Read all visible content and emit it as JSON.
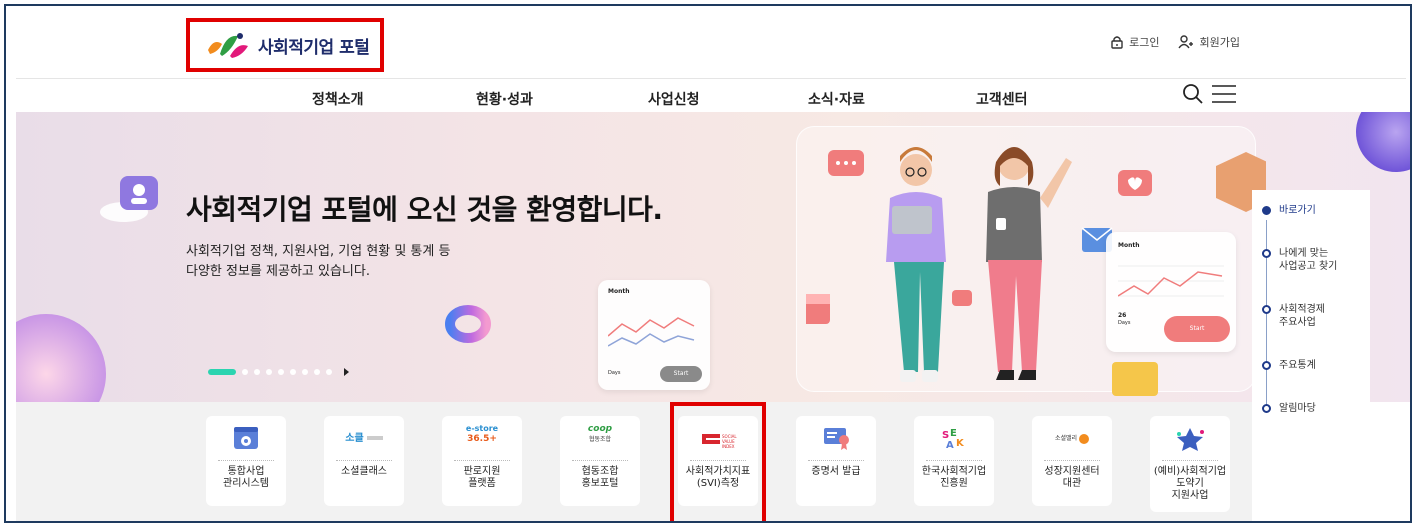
{
  "header": {
    "logo_text": "사회적기업 포털",
    "login_label": "로그인",
    "signup_label": "회원가입"
  },
  "gnb": {
    "items": [
      "정책소개",
      "현황·성과",
      "사업신청",
      "소식·자료",
      "고객센터"
    ]
  },
  "hero": {
    "title": "사회적기업 포털에 오신 것을 환영합니다.",
    "desc_line1": "사회적기업 정책, 지원사업, 기업 현황 및 통계 등",
    "desc_line2": "다양한 정보를 제공하고 있습니다.",
    "card_left_month": "Month",
    "card_left_days": "Days",
    "card_left_start": "Start",
    "card_right_month": "Month",
    "card_right_num": "26",
    "card_right_days": "Days",
    "card_right_start": "Start"
  },
  "quick_nav": {
    "items": [
      {
        "line1": "바로가기",
        "line2": ""
      },
      {
        "line1": "나에게 맞는",
        "line2": "사업공고 찾기"
      },
      {
        "line1": "사회적경제",
        "line2": "주요사업"
      },
      {
        "line1": "주요통계",
        "line2": ""
      },
      {
        "line1": "알림마당",
        "line2": ""
      }
    ]
  },
  "services": [
    {
      "line1": "통합사업",
      "line2": "관리시스템",
      "line3": "",
      "icon": "gear-window-icon"
    },
    {
      "line1": "소셜클래스",
      "line2": "",
      "line3": "",
      "icon": "social-class-logo",
      "logo": "소클"
    },
    {
      "line1": "판로지원",
      "line2": "플랫폼",
      "line3": "",
      "icon": "estore-logo",
      "logo": "e-store",
      "logo2": "36.5+"
    },
    {
      "line1": "협동조합",
      "line2": "홍보포털",
      "line3": "",
      "icon": "coop-logo",
      "logo": "coop",
      "logo2": "협동조합"
    },
    {
      "line1": "사회적가치지표",
      "line2": "(SVI)측정",
      "line3": "",
      "icon": "svi-logo"
    },
    {
      "line1": "증명서 발급",
      "line2": "",
      "line3": "",
      "icon": "certificate-icon"
    },
    {
      "line1": "한국사회적기업",
      "line2": "진흥원",
      "line3": "",
      "icon": "kosea-logo"
    },
    {
      "line1": "성장지원센터",
      "line2": "대관",
      "line3": "",
      "icon": "social-valley-logo",
      "logo": "소셜밸리"
    },
    {
      "line1": "(예비)사회적기업",
      "line2": "도약기",
      "line3": "지원사업",
      "icon": "star-logo"
    }
  ],
  "colors": {
    "highlight": "#e00000",
    "brand_navy": "#1f2d6b",
    "accent_teal": "#2bd4b0"
  }
}
